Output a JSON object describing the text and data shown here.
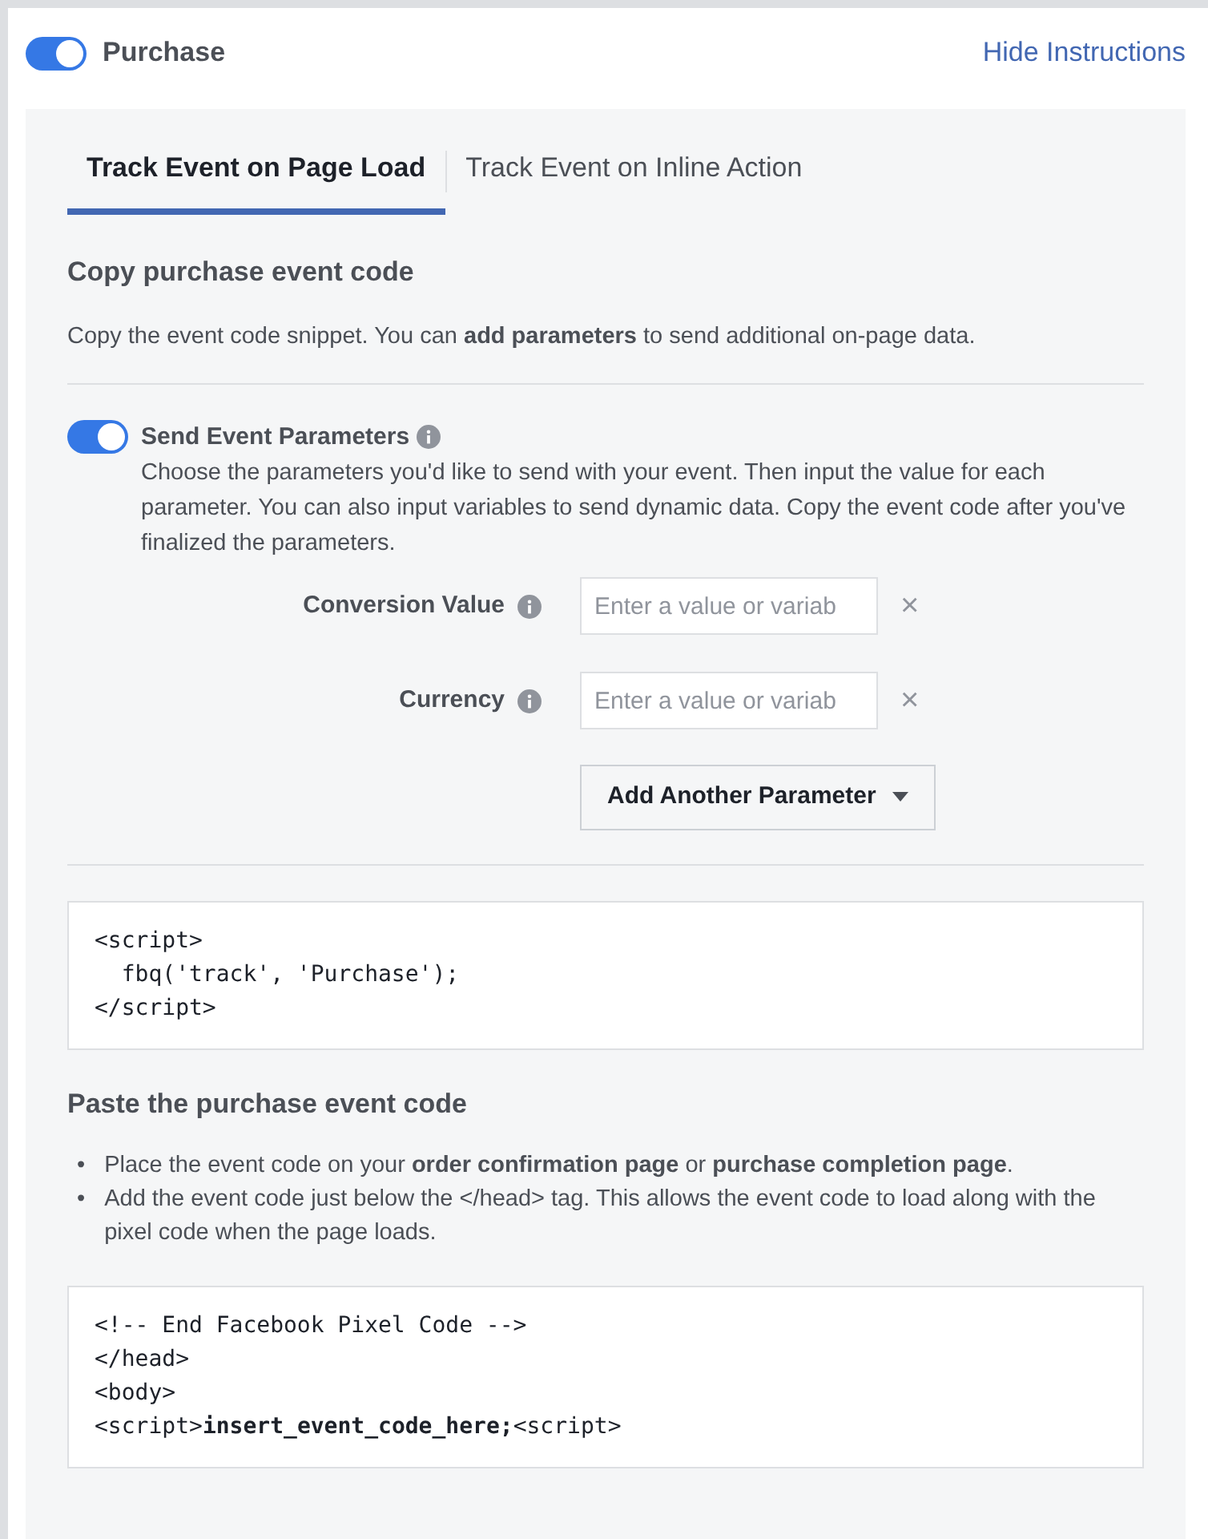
{
  "header": {
    "toggle_on": true,
    "title": "Purchase",
    "link": "Hide Instructions"
  },
  "tabs": [
    {
      "label": "Track Event on Page Load",
      "selected": true
    },
    {
      "label": "Track Event on Inline Action",
      "selected": false
    }
  ],
  "copy_section": {
    "heading": "Copy purchase event code",
    "text": "Copy the event code snippet. You can **add parameters** to send additional on-page data."
  },
  "parameters": {
    "toggle_on": true,
    "title": "Send Event Parameters",
    "description": "Choose the parameters you'd like to send with your event. Then input the value for each parameter. You can also input variables to send dynamic data. Copy the event code after you've finalized the parameters.",
    "fields": [
      {
        "label": "Conversion Value",
        "placeholder": "Enter a value or variab",
        "remove": "×"
      },
      {
        "label": "Currency",
        "placeholder": "Enter a value or variab",
        "remove": "×"
      }
    ],
    "add_button": "Add Another Parameter"
  },
  "event_code": [
    "<script>",
    "  fbq('track', 'Purchase');",
    "</script>"
  ],
  "paste_section": {
    "heading": "Paste the purchase event code",
    "bullets": [
      {
        "marker": "•",
        "text": "Place the event code on your **order confirmation page** or **purchase completion page**."
      },
      {
        "marker": "•",
        "text": "Add the event code just below the </head> tag. This allows the event code to load along with the pixel code when the page loads."
      }
    ]
  },
  "pixel_code": [
    "<!-- End Facebook Pixel Code -->",
    "</head>",
    "<body>",
    "<script>**insert_event_code_here;**<script>"
  ]
}
